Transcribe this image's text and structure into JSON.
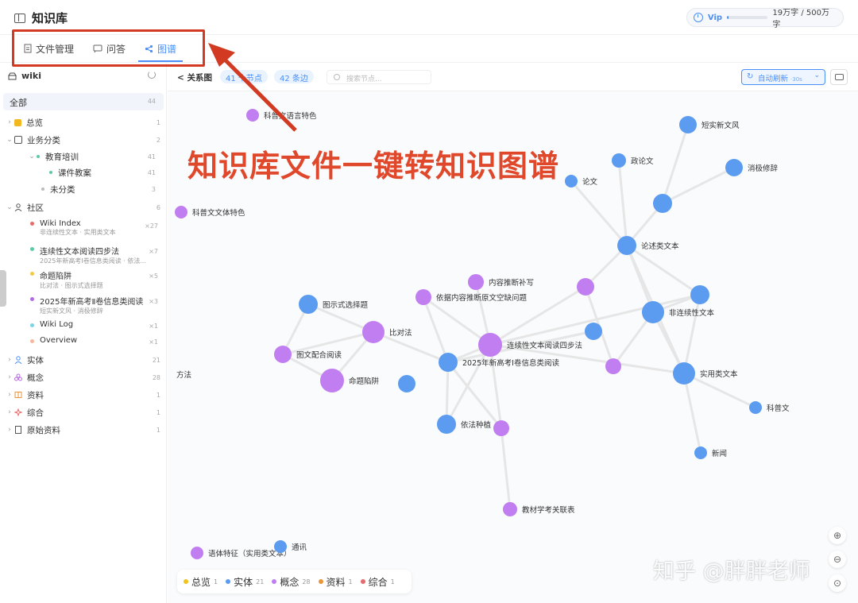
{
  "app": {
    "title": "知识库"
  },
  "vip": {
    "label": "Vip",
    "usage": "19万字 / 500万字",
    "usage_fraction": 0.038,
    "accent": "#4a8ff7"
  },
  "tabs": [
    {
      "label": "文件管理",
      "icon": "file-icon"
    },
    {
      "label": "问答",
      "icon": "chat-icon"
    },
    {
      "label": "图谱",
      "icon": "share-graph-icon",
      "active": true
    }
  ],
  "sidebar": {
    "root": "wiki",
    "all": {
      "label": "全部",
      "count": "44"
    },
    "items": [
      {
        "label": "总览",
        "count": "1",
        "icon": "grid-icon",
        "color": "#f2b822"
      },
      {
        "label": "业务分类",
        "count": "2",
        "icon": "folder-icon",
        "color": "#555555"
      },
      {
        "label": "教育培训",
        "count": "41"
      },
      {
        "label": "课件教案",
        "count": "41"
      },
      {
        "label": "未分类",
        "count": "3"
      },
      {
        "label": "社区",
        "count": "6",
        "icon": "user-icon",
        "color": "#555555"
      },
      {
        "label": "实体",
        "count": "21",
        "icon": "user-icon",
        "color": "#4a8ff7"
      },
      {
        "label": "概念",
        "count": "28",
        "icon": "concept-icon",
        "color": "#b46be0"
      },
      {
        "label": "资料",
        "count": "1",
        "icon": "book-icon",
        "color": "#e8963a"
      },
      {
        "label": "综合",
        "count": "1",
        "icon": "synthesis-icon",
        "color": "#e66b6b"
      },
      {
        "label": "原始资料",
        "count": "1",
        "icon": "document-icon",
        "color": "#555555"
      }
    ],
    "community": [
      {
        "title": "Wiki Index",
        "sub": "非连续性文本 · 实用类文本",
        "count": "×27",
        "color": "#e66b6b"
      },
      {
        "title": "连续性文本阅读四步法",
        "sub": "2025年新高考Ⅰ卷信息类阅读 · 依法...",
        "count": "×7",
        "color": "#5dc9a8"
      },
      {
        "title": "命题陷阱",
        "sub": "比对法 · 图示式选择题",
        "count": "×5",
        "color": "#f2c84a"
      },
      {
        "title": "2025年新高考Ⅱ卷信息类阅读",
        "sub": "短实新文风 · 消极修辞",
        "count": "×3",
        "color": "#b46be0"
      },
      {
        "title": "Wiki Log",
        "sub": "",
        "count": "×1",
        "color": "#7bd3e8"
      },
      {
        "title": "Overview",
        "sub": "",
        "count": "×1",
        "color": "#f4b8a0"
      }
    ]
  },
  "toolbar": {
    "title": "关系图",
    "nodes_pill": "41 个节点",
    "edges_pill": "42 条边",
    "search_placeholder": "搜索节点...",
    "auto_refresh": "自动刷新",
    "auto_interval": "·30s"
  },
  "graph": {
    "colors": {
      "entity": "#5b9cf0",
      "concept": "#c07ef0",
      "edge": "#e6e6e6"
    },
    "nodes": [
      {
        "label": "科普文语言特色",
        "type": "concept"
      },
      {
        "label": "短实新文风",
        "type": "entity"
      },
      {
        "label": "政论文",
        "type": "entity"
      },
      {
        "label": "消极修辞",
        "type": "entity"
      },
      {
        "label": "论文",
        "type": "entity"
      },
      {
        "label": "科普文文体特色",
        "type": "concept"
      },
      {
        "label": "",
        "type": "entity"
      },
      {
        "label": "论述类文本",
        "type": "entity"
      },
      {
        "label": "内容推断补写",
        "type": "concept"
      },
      {
        "label": "依据内容推断原文空缺问题",
        "type": "concept"
      },
      {
        "label": "",
        "type": "concept"
      },
      {
        "label": "",
        "type": "entity"
      },
      {
        "label": "图示式选择题",
        "type": "entity"
      },
      {
        "label": "非连续性文本",
        "type": "entity"
      },
      {
        "label": "比对法",
        "type": "concept"
      },
      {
        "label": "",
        "type": "entity"
      },
      {
        "label": "图文配合阅读",
        "type": "concept"
      },
      {
        "label": "连续性文本阅读四步法",
        "type": "concept"
      },
      {
        "label": "2025年新高考Ⅰ卷信息类阅读",
        "type": "entity"
      },
      {
        "label": "",
        "type": "concept"
      },
      {
        "label": "实用类文本",
        "type": "entity"
      },
      {
        "label": "命题陷阱",
        "type": "concept"
      },
      {
        "label": "",
        "type": "entity"
      },
      {
        "label": "方法",
        "type": "concept"
      },
      {
        "label": "科普文",
        "type": "entity"
      },
      {
        "label": "依法种植",
        "type": "entity"
      },
      {
        "label": "",
        "type": "concept"
      },
      {
        "label": "新闻",
        "type": "entity"
      },
      {
        "label": "教材学考关联表",
        "type": "concept"
      },
      {
        "label": "语体特征（实用类文本）",
        "type": "concept"
      },
      {
        "label": "通讯",
        "type": "entity"
      }
    ]
  },
  "legend": [
    {
      "label": "总览",
      "count": "1",
      "color": "#f2c31a"
    },
    {
      "label": "实体",
      "count": "21",
      "color": "#5b9cf0"
    },
    {
      "label": "概念",
      "count": "28",
      "color": "#c07ef0"
    },
    {
      "label": "资料",
      "count": "1",
      "color": "#e8963a"
    },
    {
      "label": "综合",
      "count": "1",
      "color": "#e66b6b"
    }
  ],
  "annotation": {
    "text": "知识库文件一键转知识图谱",
    "color": "#e0482b"
  },
  "watermark": "知乎 @胖胖老师"
}
